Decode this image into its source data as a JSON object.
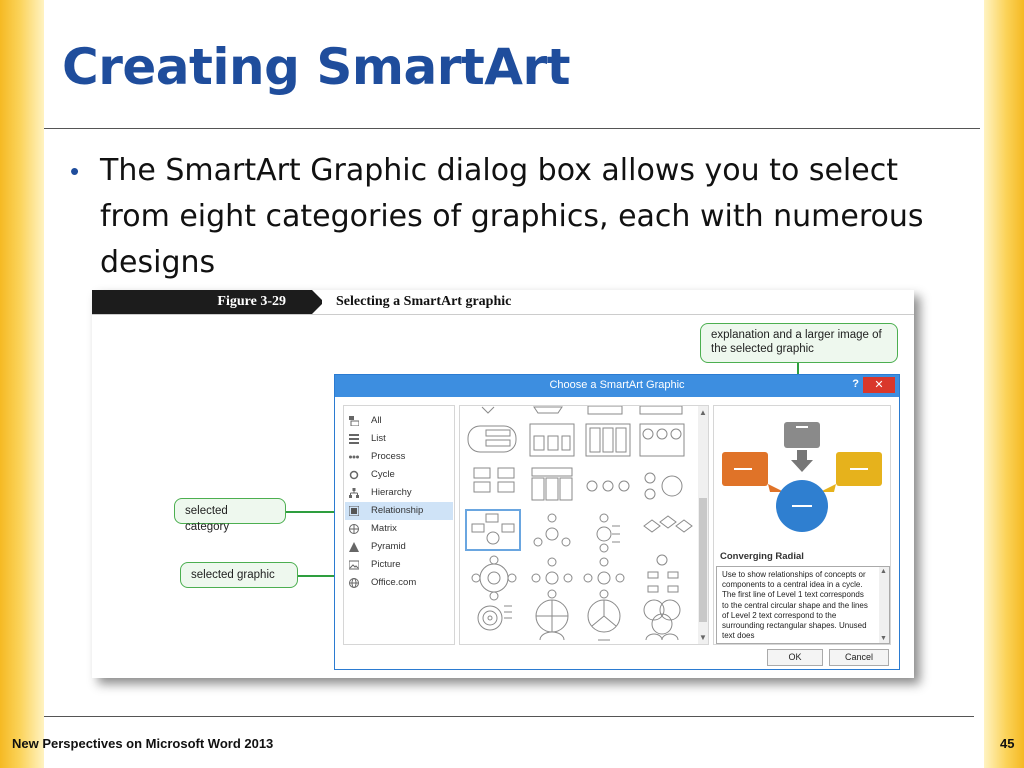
{
  "slide": {
    "title": "Creating SmartArt",
    "bullet": "The SmartArt Graphic dialog box allows you to select from eight categories of graphics, each with numerous designs",
    "footer": "New Perspectives on Microsoft Word 2013",
    "page_number": "45",
    "accent_color": "#1f4d9c",
    "side_bar_color": "#f5b923"
  },
  "figure": {
    "label": "Figure 3-29",
    "caption": "Selecting a SmartArt graphic",
    "callouts": {
      "preview_note": "explanation and a larger image of the selected graphic",
      "selected_category": "selected category",
      "selected_graphic": "selected graphic"
    },
    "callout_color": "#2e9e3f"
  },
  "dialog": {
    "title": "Choose a SmartArt Graphic",
    "help_label": "?",
    "close_label": "✕",
    "categories": [
      {
        "label": "All",
        "icon": "all-icon"
      },
      {
        "label": "List",
        "icon": "list-icon"
      },
      {
        "label": "Process",
        "icon": "process-icon"
      },
      {
        "label": "Cycle",
        "icon": "cycle-icon"
      },
      {
        "label": "Hierarchy",
        "icon": "hierarchy-icon"
      },
      {
        "label": "Relationship",
        "icon": "relationship-icon"
      },
      {
        "label": "Matrix",
        "icon": "matrix-icon"
      },
      {
        "label": "Pyramid",
        "icon": "pyramid-icon"
      },
      {
        "label": "Picture",
        "icon": "picture-icon"
      },
      {
        "label": "Office.com",
        "icon": "globe-icon"
      }
    ],
    "selected_category": "Relationship",
    "preview": {
      "name": "Converging Radial",
      "description": "Use to show relationships of concepts or components to a central idea in a cycle. The first line of Level 1 text corresponds to the central circular shape and the lines of Level 2 text correspond to the surrounding rectangular shapes. Unused text does",
      "colors": {
        "center_circle": "#2f7fd0",
        "top_box": "#8a8a8a",
        "left_box": "#e07328",
        "right_box": "#e6b21c"
      }
    },
    "buttons": {
      "ok": "OK",
      "cancel": "Cancel"
    }
  }
}
